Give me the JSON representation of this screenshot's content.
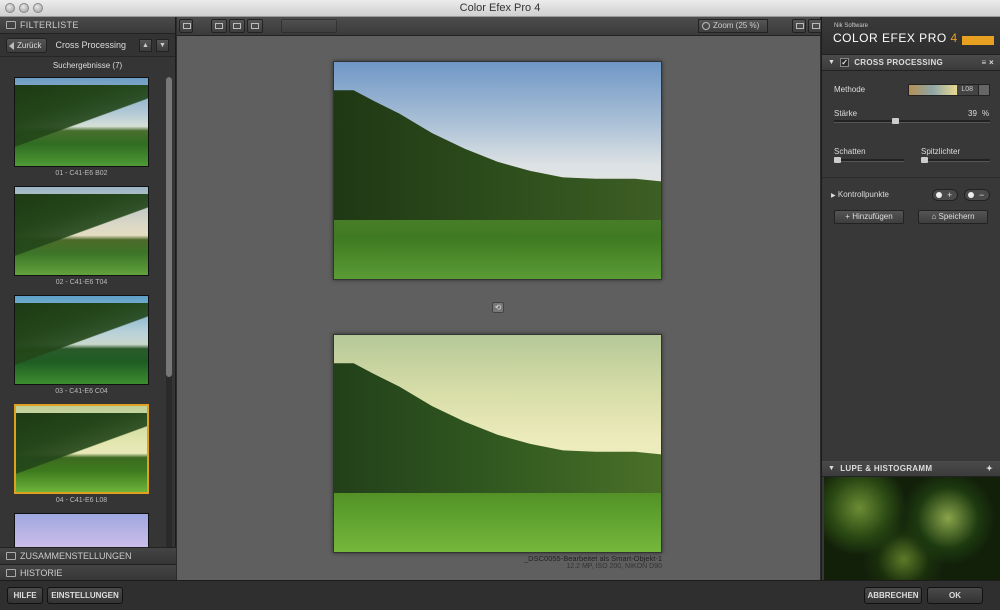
{
  "window": {
    "title": "Color Efex Pro 4"
  },
  "left_panel": {
    "header": "FILTERLISTE",
    "back_label": "Zurück",
    "nav_title": "Cross Processing",
    "up_arrow": "▲",
    "down_arrow": "▼",
    "results_label": "Suchergebnisse (7)",
    "thumbnails": [
      {
        "label": "01 - C41-E6 B02",
        "selected": false
      },
      {
        "label": "02 - C41-E6 T04",
        "selected": false
      },
      {
        "label": "03 - C41-E6 C04",
        "selected": false
      },
      {
        "label": "04 - C41-E6 L08",
        "selected": true
      },
      {
        "label": "",
        "selected": false
      }
    ],
    "tabs": [
      "ZUSAMMENSTELLUNGEN",
      "HISTORIE"
    ]
  },
  "center": {
    "zoom_label": "Zoom (25 %)",
    "caption_title": "_DSC0055-Bearbeitet als Smart-Objekt-1",
    "caption_meta": "12.2 MP, ISO 200, NIKON D90"
  },
  "right_panel": {
    "brand_small": "Nik Software",
    "brand_title": "COLOR EFEX PRO",
    "brand_version": "4",
    "filter_header": "CROSS PROCESSING",
    "filter_checked": "✓",
    "methode_label": "Methode",
    "methode_value": "L08",
    "staerke_label": "Stärke",
    "staerke_value": "39",
    "staerke_unit": "%",
    "staerke_fraction": 0.39,
    "schatten_label": "Schatten",
    "spitzlichter_label": "Spitzlichter",
    "kontrollpunkte_label": "Kontrollpunkte",
    "cp_plus": "+",
    "cp_minus": "−",
    "hinzufuegen_label": "Hinzufügen",
    "speichern_label": "Speichern",
    "lupe_header": "LUPE & HISTOGRAMM"
  },
  "bottom_bar": {
    "hilfe": "HILFE",
    "einstellungen": "EINSTELLUNGEN",
    "abbrechen": "ABBRECHEN",
    "ok": "OK"
  },
  "colors": {
    "accent": "#e0a020",
    "panel": "#353535",
    "canvas": "#5f5f5f"
  }
}
